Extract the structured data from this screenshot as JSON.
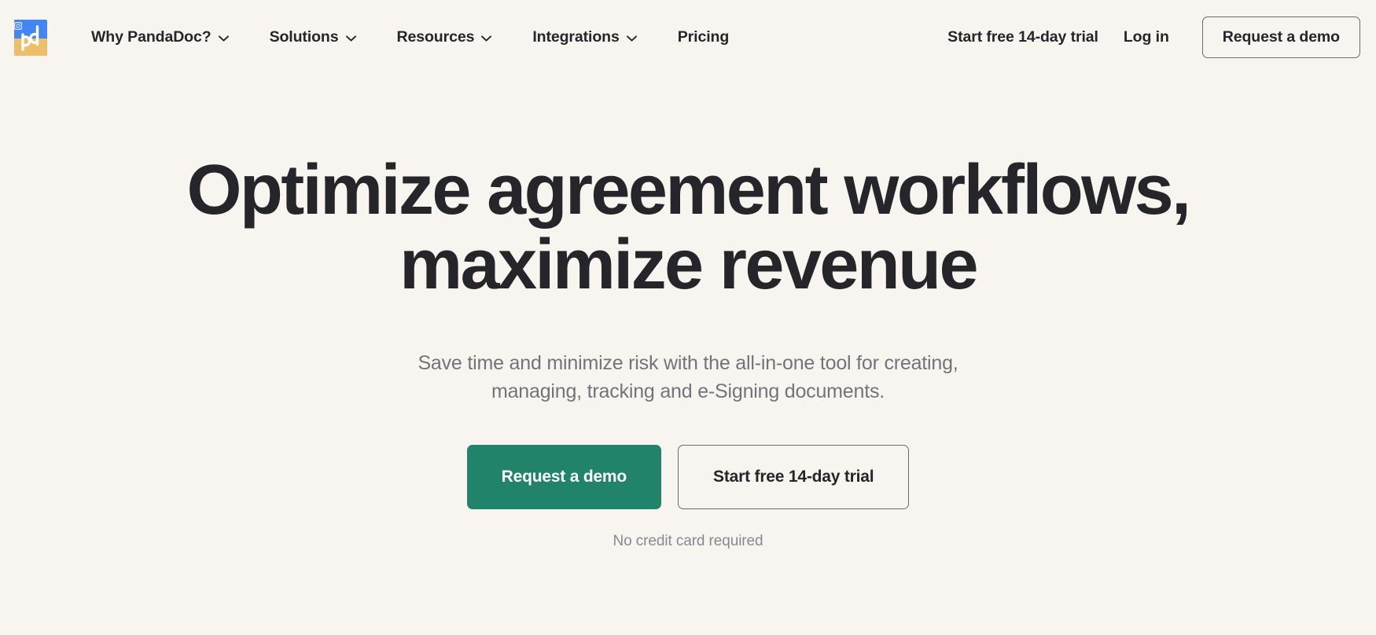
{
  "brand": {
    "logo_name": "pandadoc-logo",
    "logo_mark": "pd",
    "registered_mark": "®",
    "colors": {
      "logo_top": "#4285f4",
      "logo_bottom": "#eebf6a"
    }
  },
  "colors": {
    "page_background": "#f8f4f0",
    "text_primary": "#26262a",
    "text_muted": "#75737a",
    "note_text": "#8a8891",
    "primary_button": "#21836a",
    "outline_border": "#6e6a66"
  },
  "nav": {
    "items": [
      {
        "label": "Why PandaDoc?",
        "has_dropdown": true
      },
      {
        "label": "Solutions",
        "has_dropdown": true
      },
      {
        "label": "Resources",
        "has_dropdown": true
      },
      {
        "label": "Integrations",
        "has_dropdown": true
      },
      {
        "label": "Pricing",
        "has_dropdown": false
      }
    ],
    "trial_link": "Start free 14-day trial",
    "login_link": "Log in",
    "demo_button": "Request a demo"
  },
  "hero": {
    "headline_line1": "Optimize agreement workflows,",
    "headline_line2": "maximize revenue",
    "subheading_line1": "Save time and minimize risk with the all-in-one tool for creating,",
    "subheading_line2": "managing, tracking and e-Signing documents.",
    "primary_cta": "Request a demo",
    "secondary_cta": "Start free 14-day trial",
    "note": "No credit card required"
  }
}
